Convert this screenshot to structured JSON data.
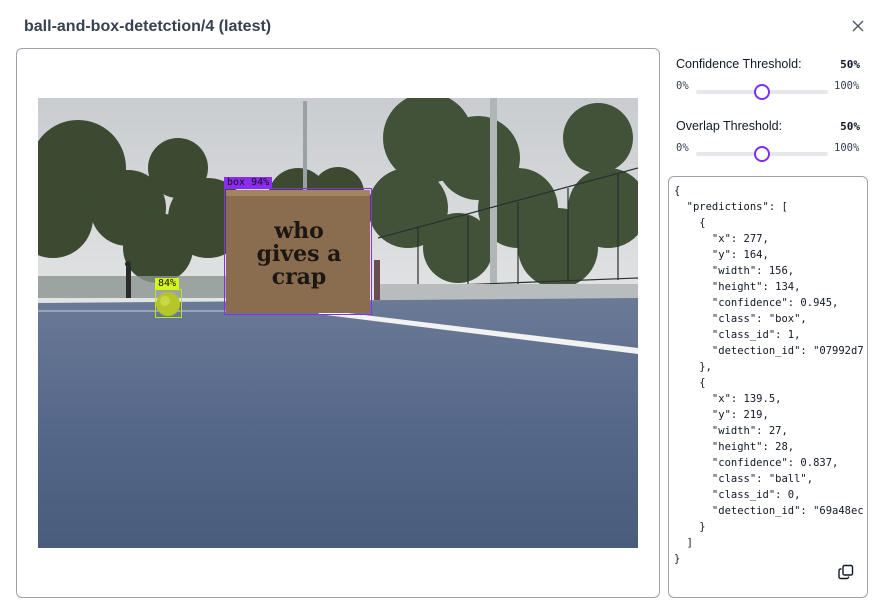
{
  "dialog": {
    "title": "ball-and-box-detetction/4 (latest)",
    "close_icon": "close-icon"
  },
  "detections": {
    "box_label": "box 94%",
    "ball_label": "84%",
    "box_color": "#8b2cf5",
    "ball_color": "#d4f51d"
  },
  "sign_text": [
    "who",
    "gives a",
    "crap"
  ],
  "confidence": {
    "label": "Confidence Threshold:",
    "value_text": "50%",
    "value": 0.5,
    "min": "0%",
    "max": "100%"
  },
  "overlap": {
    "label": "Overlap Threshold:",
    "value_text": "50%",
    "value": 0.5,
    "min": "0%",
    "max": "100%"
  },
  "json_output": "{\n  \"predictions\": [\n    {\n      \"x\": 277,\n      \"y\": 164,\n      \"width\": 156,\n      \"height\": 134,\n      \"confidence\": 0.945,\n      \"class\": \"box\",\n      \"class_id\": 1,\n      \"detection_id\": \"07992d7\n    },\n    {\n      \"x\": 139.5,\n      \"y\": 219,\n      \"width\": 27,\n      \"height\": 28,\n      \"confidence\": 0.837,\n      \"class\": \"ball\",\n      \"class_id\": 0,\n      \"detection_id\": \"69a48ec\n    }\n  ]\n}",
  "copy_icon": "copy-icon",
  "accent_color": "#7c2ff2"
}
